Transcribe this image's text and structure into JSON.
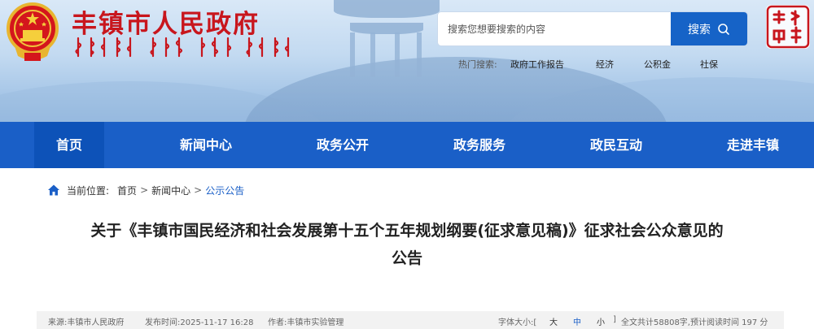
{
  "header": {
    "site_title": "丰镇市人民政府",
    "seal_text": [
      "丰镇",
      "市"
    ],
    "search": {
      "placeholder": "搜索您想要搜索的内容",
      "button_label": "搜索"
    },
    "hot_search": {
      "label": "热门搜索:",
      "items": [
        "政府工作报告",
        "经济",
        "公积金",
        "社保"
      ]
    }
  },
  "nav": {
    "items": [
      "首页",
      "新闻中心",
      "政务公开",
      "政务服务",
      "政民互动",
      "走进丰镇"
    ],
    "active_index": 0
  },
  "breadcrumb": {
    "label": "当前位置:",
    "items": [
      "首页",
      "新闻中心",
      "公示公告"
    ],
    "separator": ">"
  },
  "article": {
    "title_line1": "关于《丰镇市国民经济和社会发展第十五个五年规划纲要(征求意见稿)》征求社会公众意见的",
    "title_line2": "公告",
    "meta": {
      "source": "来源:丰镇市人民政府",
      "published": "发布时间:2025-11-17 16:28",
      "author": "作者:丰镇市实验管理",
      "font_size_label": "字体大小:[",
      "size_large": "大",
      "size_medium": "中",
      "size_small": "小",
      "size_close": "]",
      "word_count": "全文共计58808字,预计阅读时间 197 分"
    }
  },
  "colors": {
    "brand_red": "#c8161d",
    "nav_blue": "#1a5fc7",
    "search_blue": "#1663c7"
  }
}
